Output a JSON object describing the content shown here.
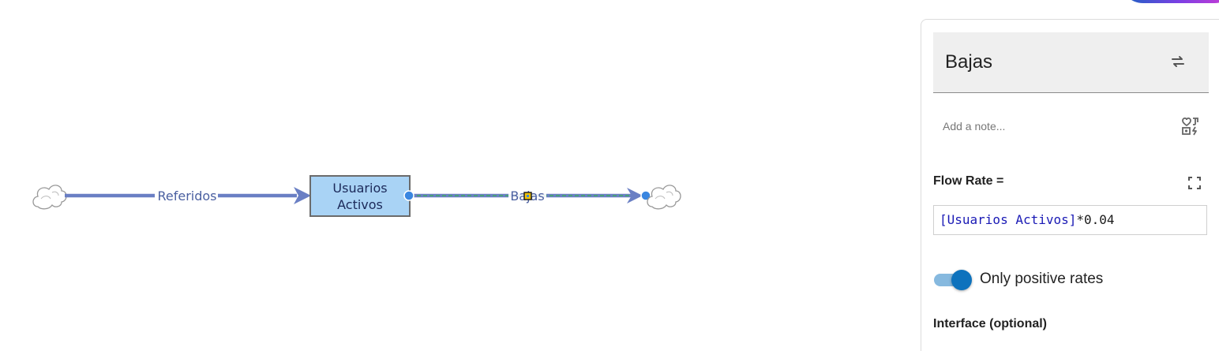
{
  "diagram": {
    "source_flow_label": "Referidos",
    "stock_label_line1": "Usuarios",
    "stock_label_line2": "Activos",
    "selected_flow_label": "Bajas"
  },
  "panel": {
    "title": "Bajas",
    "note_placeholder": "Add a note...",
    "flow_rate_label": "Flow Rate =",
    "equation_variable": "[Usuarios Activos]",
    "equation_operator": "*0.04",
    "toggle_label": "Only positive rates",
    "toggle_on": true,
    "interface_label": "Interface (optional)"
  },
  "colors": {
    "flow": "#6a7fc4",
    "stock_fill": "#a9d3f5",
    "selected_flow": "#4aa07a",
    "accent": "#0d72bd"
  },
  "icons": [
    "cloud-icon",
    "swap-icon",
    "note-tools-icon",
    "expand-icon"
  ]
}
